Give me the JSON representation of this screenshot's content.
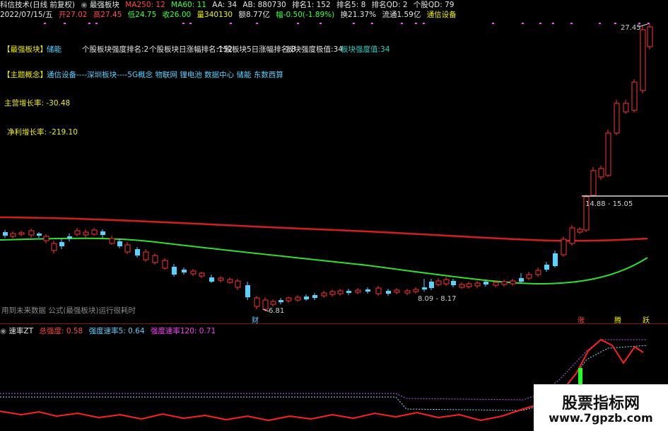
{
  "header1": {
    "stock": "科信技术(日线 前复权)",
    "indicator_icon": "circle-icon",
    "indicator_name": "最强板块",
    "ma250": "MA250: 12",
    "ma60": "MA60: 11",
    "aa": "AA: 34",
    "ab": "AB: 880730",
    "rank1": "排名1: 152",
    "rank5": "排名5: 8",
    "rankqd": "排名QD: 2",
    "gegu": "个股QD: 79"
  },
  "header2": {
    "date": "2022/07/15/五",
    "open": "开27.02",
    "high": "高27.45",
    "low": "低24.75",
    "close": "收26.00",
    "volume": "量340130",
    "amount": "额8.77亿",
    "change": "幅-0.50(-1.89%)",
    "turnover": "换21.37%",
    "float": "流通1.59亿",
    "sector": "通信设备"
  },
  "info": {
    "strongest_label": "【最强板块】",
    "strongest_value": "储能",
    "rank_strength": "个股板块强度排名:2",
    "rank_day": "个股板块日涨幅排名:152",
    "rank_5day": "个股板块5日涨幅排名:8",
    "limit": "板块强度极值:34",
    "strength": "板块强度值:34",
    "theme_label": "【主题概念】",
    "theme_value": "通信设备----深圳板块----5G概念 物联网 锂电池 数据中心 储能 东数西算",
    "revenue": "主营增长率: -30.48",
    "profit": "净利增长率: -219.10",
    "future_note": "用到未来数据 公式(最强板块)运行很耗时"
  },
  "price_labels": {
    "top": "27.45",
    "range": "14.88 - 15.05",
    "low": "6.81",
    "mid": "8.09 - 8.17"
  },
  "markers": {
    "cai": "财",
    "zhang": "涨",
    "teng": "腾",
    "yue": "跃"
  },
  "sub": {
    "icon": "circle-icon",
    "name": "速率ZT",
    "total": "总强度: 0.58",
    "speed5": "强度速率5: 0.64",
    "speed120": "强度速率120: 0.71"
  },
  "watermark": {
    "title": "股票指标网",
    "url": "www.7gpzb.com"
  },
  "colors": {
    "up": "#ff3232",
    "down": "#5ad2ff",
    "ma_red": "#d21e1e",
    "ma_green": "#2ee02e"
  }
}
